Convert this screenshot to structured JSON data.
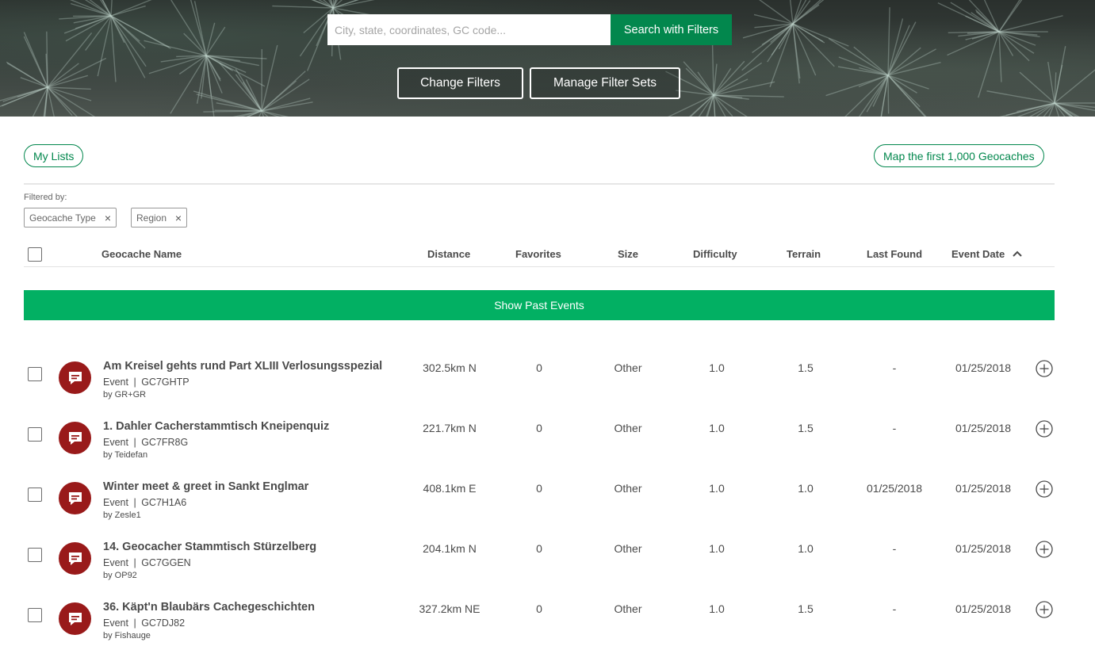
{
  "search": {
    "placeholder": "City, state, coordinates, GC code...",
    "button_label": "Search with Filters"
  },
  "hero_buttons": {
    "change_filters": "Change Filters",
    "manage_filter_sets": "Manage Filter Sets"
  },
  "toolbar": {
    "my_lists": "My Lists",
    "map_first": "Map the first 1,000 Geocaches"
  },
  "filters": {
    "label": "Filtered by:",
    "chips": [
      "Geocache Type",
      "Region"
    ],
    "remove_glyph": "×"
  },
  "table": {
    "columns": {
      "name": "Geocache Name",
      "distance": "Distance",
      "favorites": "Favorites",
      "size": "Size",
      "difficulty": "Difficulty",
      "terrain": "Terrain",
      "last_found": "Last Found",
      "event_date": "Event Date"
    },
    "sort": {
      "column": "Event Date",
      "direction": "ascending",
      "icon": "chevron-up-icon"
    },
    "show_past_label": "Show Past Events",
    "rows": [
      {
        "name": "Am Kreisel gehts rund Part XLIII Verlosungsspezial",
        "type": "Event",
        "code": "GC7GHTP",
        "owner": "by GR+GR",
        "distance": "302.5km N",
        "favorites": "0",
        "size": "Other",
        "difficulty": "1.0",
        "terrain": "1.5",
        "last_found": "-",
        "event_date": "01/25/2018"
      },
      {
        "name": "1. Dahler Cacherstammtisch Kneipenquiz",
        "type": "Event",
        "code": "GC7FR8G",
        "owner": "by Teidefan",
        "distance": "221.7km N",
        "favorites": "0",
        "size": "Other",
        "difficulty": "1.0",
        "terrain": "1.5",
        "last_found": "-",
        "event_date": "01/25/2018"
      },
      {
        "name": "Winter meet & greet in Sankt Englmar",
        "type": "Event",
        "code": "GC7H1A6",
        "owner": "by Zesle1",
        "distance": "408.1km E",
        "favorites": "0",
        "size": "Other",
        "difficulty": "1.0",
        "terrain": "1.0",
        "last_found": "01/25/2018",
        "event_date": "01/25/2018"
      },
      {
        "name": "14. Geocacher Stammtisch Stürzelberg",
        "type": "Event",
        "code": "GC7GGEN",
        "owner": "by OP92",
        "distance": "204.1km N",
        "favorites": "0",
        "size": "Other",
        "difficulty": "1.0",
        "terrain": "1.0",
        "last_found": "-",
        "event_date": "01/25/2018"
      },
      {
        "name": "36. Käpt'n Blaubärs Cachegeschichten",
        "type": "Event",
        "code": "GC7DJ82",
        "owner": "by Fishauge",
        "distance": "327.2km NE",
        "favorites": "0",
        "size": "Other",
        "difficulty": "1.0",
        "terrain": "1.5",
        "last_found": "-",
        "event_date": "01/25/2018"
      }
    ]
  },
  "colors": {
    "brand_green": "#02874d",
    "show_past_green": "#02b063",
    "event_icon_red": "#991a1a"
  },
  "icons": {
    "row_type": "event-chat-icon",
    "row_action": "add-circle-icon"
  }
}
